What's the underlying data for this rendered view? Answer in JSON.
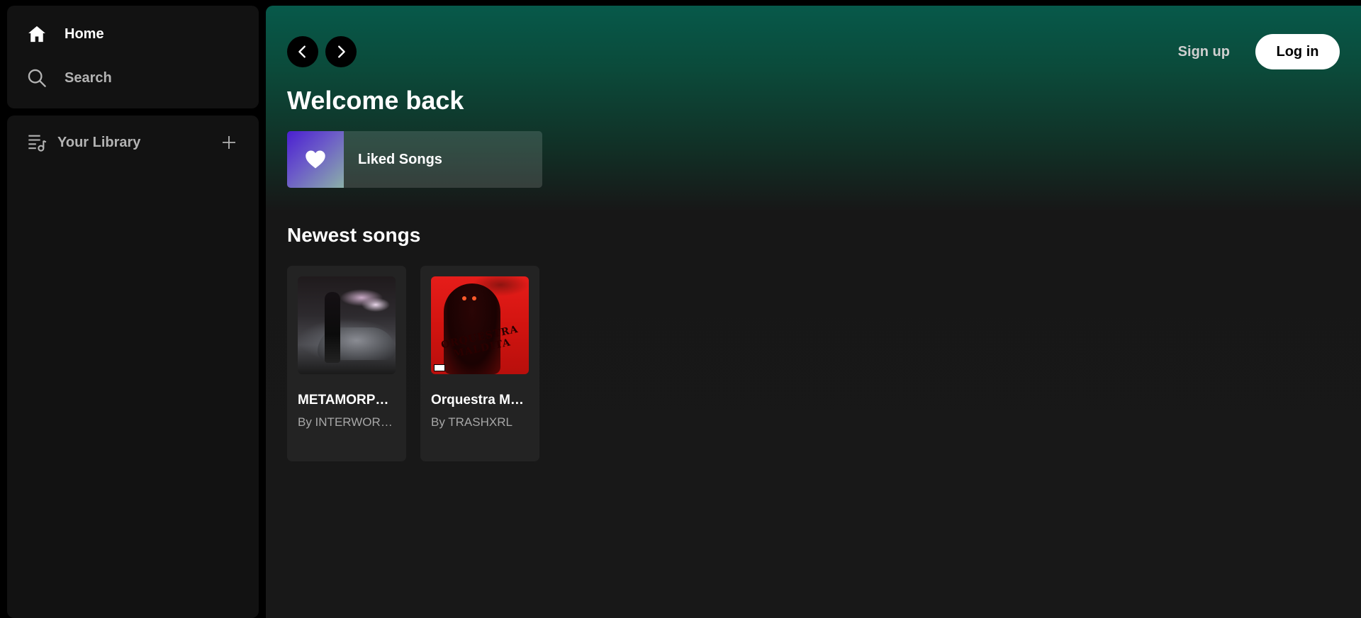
{
  "sidebar": {
    "nav": [
      {
        "label": "Home",
        "icon": "home-icon",
        "active": true
      },
      {
        "label": "Search",
        "icon": "search-icon",
        "active": false
      }
    ],
    "library": {
      "label": "Your Library",
      "icon": "library-icon",
      "add_icon": "plus-icon"
    }
  },
  "header": {
    "back_icon": "chevron-left-icon",
    "forward_icon": "chevron-right-icon",
    "signup_label": "Sign up",
    "login_label": "Log in"
  },
  "main": {
    "greeting": "Welcome back",
    "liked": {
      "label": "Liked Songs",
      "icon": "heart-icon"
    },
    "newest_title": "Newest songs",
    "songs": [
      {
        "title": "METAMORPHOSIS",
        "artist": "By INTERWORLD"
      },
      {
        "title": "Orquestra Maldita",
        "artist": "By TRASHXRL"
      }
    ]
  },
  "colors": {
    "background": "#000000",
    "panel": "#121212",
    "main_gradient_top": "#07594a",
    "main_bg": "#181818",
    "card": "#232323",
    "text_primary": "#ffffff",
    "text_secondary": "#a7a7a7"
  }
}
